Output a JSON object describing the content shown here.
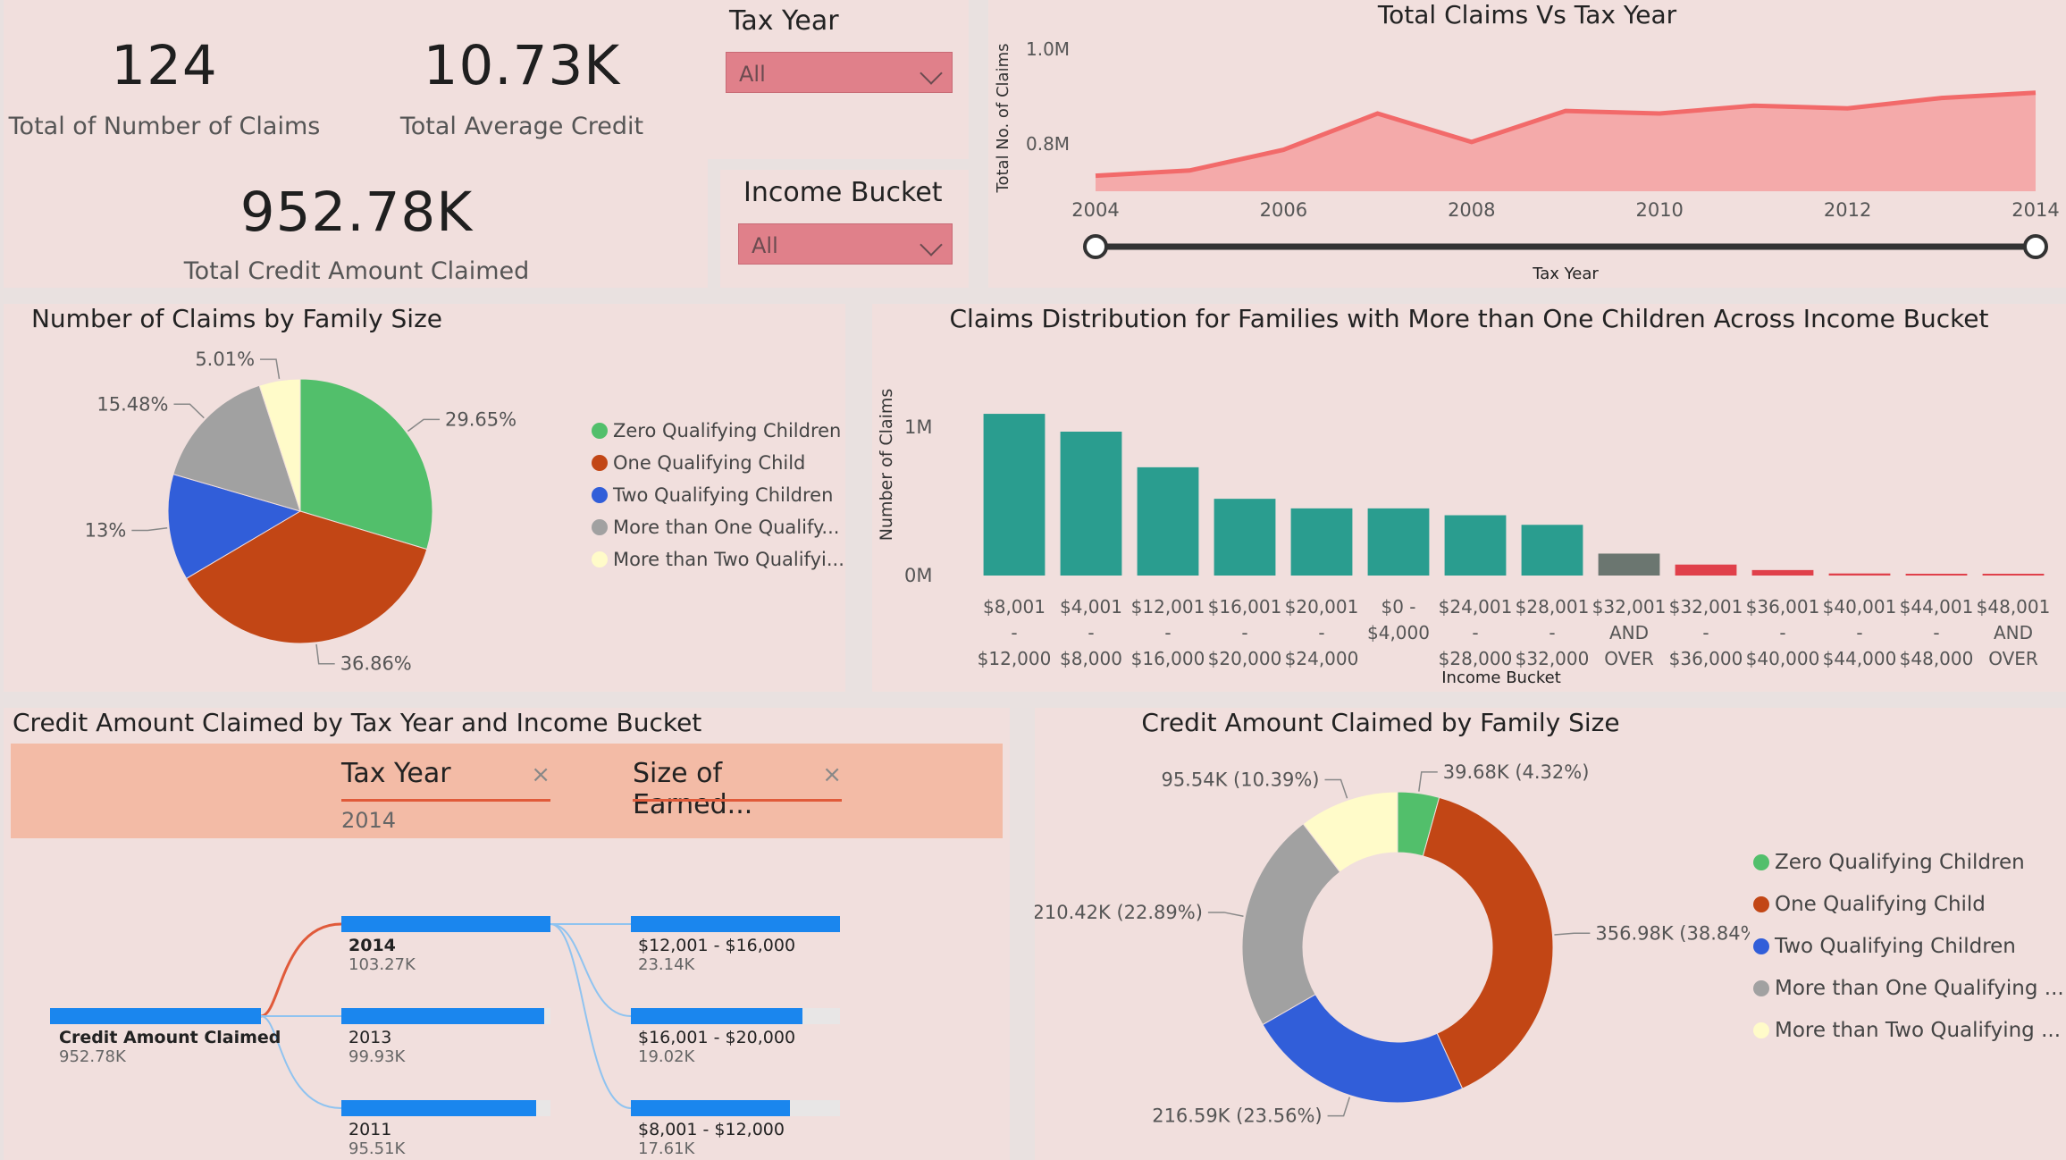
{
  "kpis": {
    "claims_value": "124",
    "claims_label": "Total of Number of Claims",
    "avg_value": "10.73K",
    "avg_label": "Total Average Credit",
    "credit_value": "952.78K",
    "credit_label": "Total Credit Amount Claimed"
  },
  "slicers": {
    "tax_year": {
      "title": "Tax Year",
      "selected": "All"
    },
    "income_bucket": {
      "title": "Income Bucket",
      "selected": "All"
    }
  },
  "family_colors": [
    "#52bf6b",
    "#c24615",
    "#315ed9",
    "#a1a1a1",
    "#fffbc9"
  ],
  "family_legend": [
    "Zero Qualifying Children",
    "One Qualifying Child",
    "Two Qualifying Children",
    "More than One Qualify...",
    "More than Two Qualifyi..."
  ],
  "family_legend_donut": [
    "Zero Qualifying Children",
    "One Qualifying Child",
    "Two Qualifying Children",
    "More than One Qualifying ...",
    "More than Two Qualifying ..."
  ],
  "line_chart": {
    "type": "area",
    "title": "Total Claims Vs Tax Year",
    "ylabel": "Total No. of Claims",
    "xlabel": "Tax Year",
    "ytick_labels": [
      "1.0M",
      "0.8M"
    ],
    "ytick_values": [
      1000000,
      800000
    ],
    "xtick_labels": [
      "2004",
      "2006",
      "2008",
      "2010",
      "2012",
      "2014"
    ],
    "chart_data": {
      "type": "area",
      "x": [
        2004,
        2005,
        2006,
        2007,
        2008,
        2009,
        2010,
        2011,
        2012,
        2013,
        2014
      ],
      "values": [
        760000,
        770000,
        810000,
        880000,
        825000,
        885000,
        880000,
        895000,
        890000,
        910000,
        920000
      ],
      "ylim": [
        730000,
        1030000
      ],
      "color": "#f26a6a",
      "fill": "#f4aaaa"
    },
    "slider": {
      "from": 2004,
      "to": 2014
    }
  },
  "pie_chart": {
    "title": "Number of Claims by Family Size",
    "chart_data": {
      "type": "pie",
      "labels": [
        "29.65%",
        "36.86%",
        "13%",
        "15.48%",
        "5.01%"
      ],
      "values": [
        29.65,
        36.86,
        13.0,
        15.48,
        5.01
      ]
    }
  },
  "bar_chart": {
    "title": "Claims Distribution for Families with More than One Children Across Income Bucket",
    "ylabel": "Number of Claims",
    "xlabel": "Income Bucket",
    "ytick_labels": [
      "1M",
      "0M"
    ],
    "chart_data": {
      "type": "bar",
      "categories": [
        [
          "$8,001",
          "-",
          "$12,000"
        ],
        [
          "$4,001",
          "-",
          "$8,000"
        ],
        [
          "$12,001",
          "-",
          "$16,000"
        ],
        [
          "$16,001",
          "-",
          "$20,000"
        ],
        [
          "$20,001",
          "-",
          "$24,000"
        ],
        [
          "$0 -",
          "$4,000"
        ],
        [
          "$24,001",
          "-",
          "$28,000"
        ],
        [
          "$28,001",
          "-",
          "$32,000"
        ],
        [
          "$32,001",
          "AND",
          "OVER"
        ],
        [
          "$32,001",
          "-",
          "$36,000"
        ],
        [
          "$36,001",
          "-",
          "$40,000"
        ],
        [
          "$40,001",
          "-",
          "$44,000"
        ],
        [
          "$44,001",
          "-",
          "$48,000"
        ],
        [
          "$48,001",
          "AND",
          "OVER"
        ]
      ],
      "values": [
        1180000,
        1050000,
        790000,
        560000,
        490000,
        490000,
        440000,
        370000,
        160000,
        80000,
        40000,
        15000,
        10000,
        8000
      ],
      "colors": [
        "#2a9d8f",
        "#2a9d8f",
        "#2a9d8f",
        "#2a9d8f",
        "#2a9d8f",
        "#2a9d8f",
        "#2a9d8f",
        "#2a9d8f",
        "#6b7670",
        "#e0404a",
        "#e0404a",
        "#e0404a",
        "#e0404a",
        "#e0404a"
      ],
      "ylim": [
        0,
        1200000
      ]
    }
  },
  "decomp": {
    "title": "Credit Amount Claimed by Tax Year and Income Bucket",
    "field1": "Tax Year",
    "field1_value": "2014",
    "field2": "Size of Earned...",
    "close": "×",
    "root": {
      "label": "Credit Amount Claimed",
      "value": "952.78K"
    },
    "level1": [
      {
        "label": "2014",
        "value": "103.27K",
        "pct": 1.0
      },
      {
        "label": "2013",
        "value": "99.93K",
        "pct": 0.97
      },
      {
        "label": "2011",
        "value": "95.51K",
        "pct": 0.93
      }
    ],
    "level2": [
      {
        "label": "$12,001 - $16,000",
        "value": "23.14K",
        "pct": 1.0
      },
      {
        "label": "$16,001 - $20,000",
        "value": "19.02K",
        "pct": 0.82
      },
      {
        "label": "$8,001 - $12,000",
        "value": "17.61K",
        "pct": 0.76
      }
    ]
  },
  "donut_chart": {
    "title": "Credit Amount Claimed by Family Size",
    "chart_data": {
      "type": "pie",
      "labels": [
        "39.68K (4.32%)",
        "356.98K (38.84%)",
        "216.59K (23.56%)",
        "210.42K (22.89%)",
        "95.54K (10.39%)"
      ],
      "values": [
        39.68,
        356.98,
        216.59,
        210.42,
        95.54
      ]
    }
  }
}
